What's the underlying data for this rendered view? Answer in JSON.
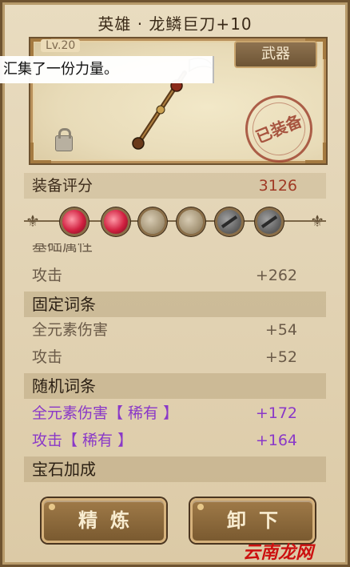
{
  "title": "英雄 · 龙鳞巨刀+10",
  "category": "武器",
  "level": "Lv.20",
  "toast": "汇集了一份力量。",
  "equipped_stamp": "已装备",
  "score": {
    "label": "装备评分",
    "value": "3126"
  },
  "gems": [
    "red",
    "red",
    "empty",
    "empty",
    "locked",
    "locked"
  ],
  "partial_header": "基础属性",
  "base_stats": [
    {
      "label": "攻击",
      "value": "+262"
    }
  ],
  "fixed_header": "固定词条",
  "fixed_stats": [
    {
      "label": "全元素伤害",
      "value": "+54"
    },
    {
      "label": "攻击",
      "value": "+52"
    }
  ],
  "random_header": "随机词条",
  "random_stats": [
    {
      "label": "全元素伤害【 稀有 】",
      "value": "+172"
    },
    {
      "label": "攻击【 稀有 】",
      "value": "+164"
    }
  ],
  "gem_header": "宝石加成",
  "buttons": {
    "refine": "精炼",
    "unequip": "卸下"
  },
  "watermark": "云南龙网",
  "colors": {
    "rare": "#8a38c8",
    "score": "#a03a25",
    "gem_red": "#d12040"
  }
}
